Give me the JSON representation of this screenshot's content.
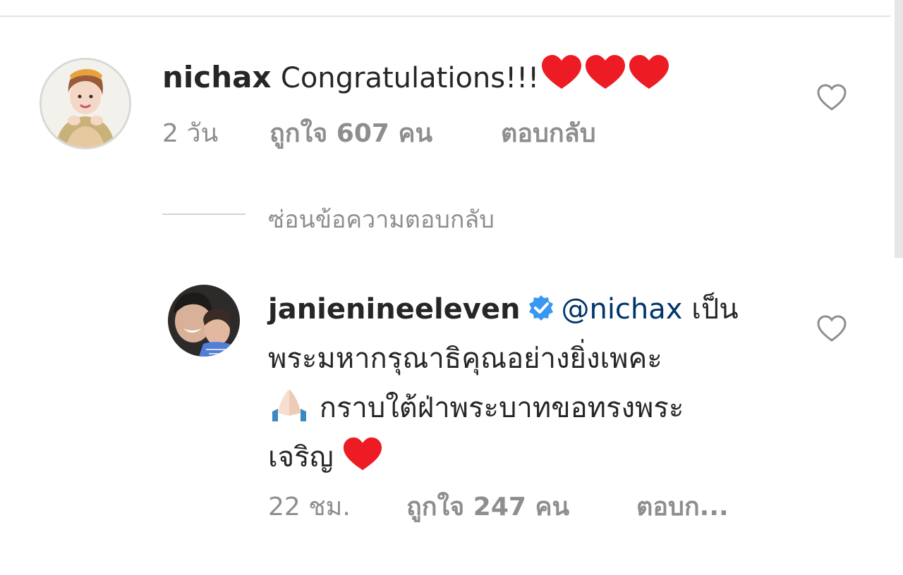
{
  "comment": {
    "username": "nichax",
    "text": "Congratulations!!!",
    "time": "2 วัน",
    "likes": "ถูกใจ 607 คน",
    "reply": "ตอบกลับ",
    "emoji_icons": [
      "red-heart-emoji",
      "red-heart-emoji",
      "red-heart-emoji"
    ]
  },
  "hide_replies": {
    "label": "ซ่อนข้อความตอบกลับ"
  },
  "reply": {
    "username": "janienineeleven",
    "verified_icon": "verified-badge-icon",
    "mention": "@nichax",
    "line1_text": "เป็น",
    "line2_text": "พระมหากรุณาธิคุณอย่างยิ่งเพคะ",
    "line3_text": "กราบใต้ฝ่าพระบาทขอทรงพระ",
    "line4_text": "เจริญ",
    "time": "22 ชม.",
    "likes": "ถูกใจ 247 คน",
    "reply": "ตอบก..."
  },
  "icons": {
    "like": "heart-outline-icon",
    "pray": "folded-hands-emoji"
  },
  "colors": {
    "text": "#262626",
    "secondary": "#8e8e8e",
    "mention": "#003569",
    "verified": "#3897f0",
    "heart": "#ed1c24"
  }
}
